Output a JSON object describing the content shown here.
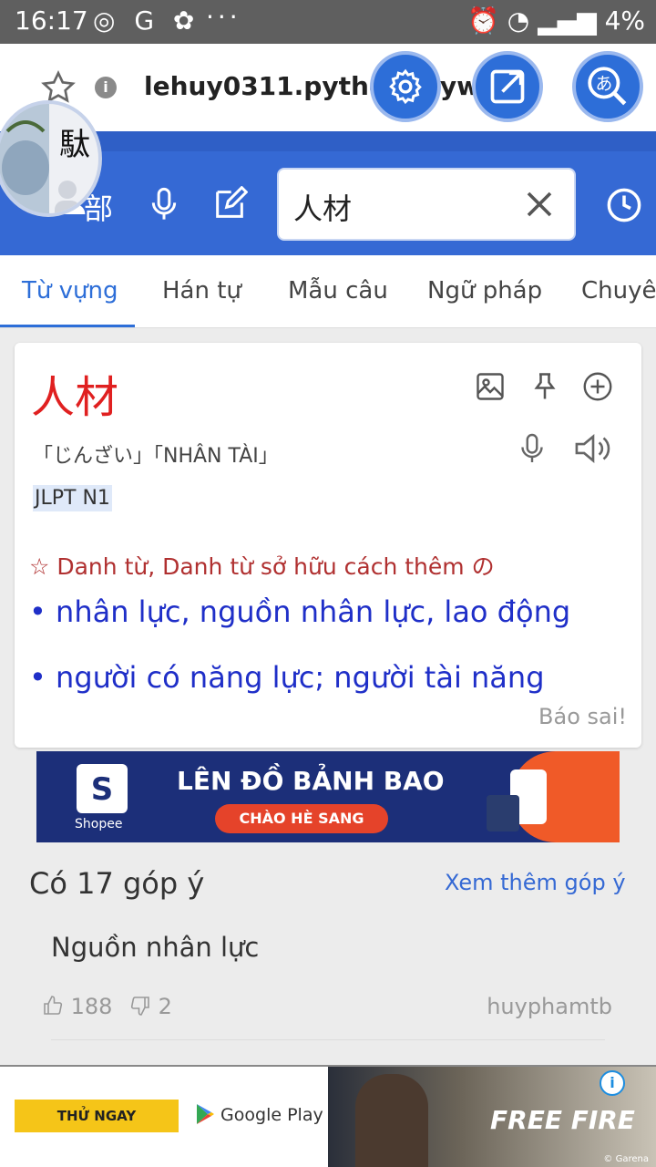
{
  "status_bar": {
    "time": "16:17",
    "left_icons": "◎ G ✿",
    "more": "···",
    "right_icons": "⏰ ◔ ▂▄▆",
    "battery": "4%"
  },
  "browser": {
    "url": "lehuy0311.pythonanywhere"
  },
  "app_header": {
    "radical_button_label": "部",
    "search_query": "人材"
  },
  "tabs": [
    {
      "label": "Từ vựng",
      "active": true
    },
    {
      "label": "Hán tự",
      "active": false
    },
    {
      "label": "Mẫu câu",
      "active": false
    },
    {
      "label": "Ngữ pháp",
      "active": false
    },
    {
      "label": "Chuyên",
      "active": false
    }
  ],
  "word_card": {
    "word": "人材",
    "reading": "「じんざい」「NHÂN TÀI」",
    "jlpt": "JLPT N1",
    "part_of_speech": "☆ Danh từ, Danh từ sở hữu cách thêm の",
    "meanings": [
      "• nhân lực, nguồn nhân lực, lao động",
      "• người có năng lực; người tài năng"
    ],
    "report_link": "Báo sai!"
  },
  "banner_ad": {
    "brand": "Shopee",
    "logo_letter": "S",
    "headline": "LÊN ĐỒ BẢNH BAO",
    "pill": "CHÀO HÈ SANG"
  },
  "comments": {
    "count_label": "Có 17 góp ý",
    "see_more": "Xem thêm góp ý",
    "items": [
      {
        "text": "Nguồn nhân lực",
        "likes": "188",
        "dislikes": "2",
        "user": "huyphamtb"
      }
    ]
  },
  "bottom_ad": {
    "cta": "THỬ NGAY",
    "store": "Google Play",
    "game": "FREE FIRE",
    "publisher": "© Garena",
    "info": "i"
  },
  "colors": {
    "header_blue": "#3569d4",
    "word_red": "#e02020",
    "meaning_blue": "#1f2fc8",
    "pos_red": "#b03030"
  }
}
